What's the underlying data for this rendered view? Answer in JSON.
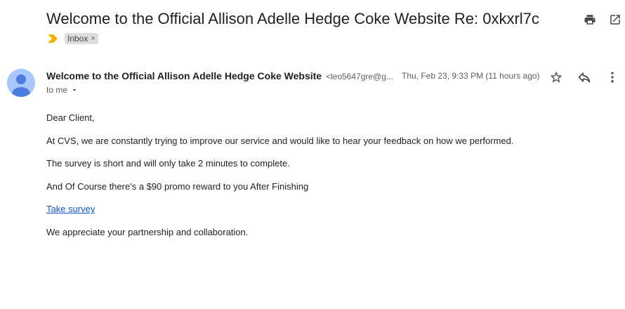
{
  "email": {
    "subject": "Welcome to the Official Allison Adelle Hedge Coke Website Re: 0xkxrl7c",
    "labels": [
      {
        "name": "Inbox",
        "remove": "×"
      }
    ],
    "sender": {
      "name": "Welcome to the Official Allison Adelle Hedge Coke Website",
      "email": "<leo5647gre@g..."
    },
    "date": "Thu, Feb 23, 9:33 PM (11 hours ago)",
    "recipient": "to me",
    "body": {
      "greeting": "Dear Client,",
      "paragraph1": "At CVS, we are constantly trying to improve our service and would like to hear your feedback on how we performed.",
      "paragraph2": "The survey is short and will only take 2 minutes to complete.",
      "paragraph3": "And Of Course there's a $90 promo reward to you After Finishing",
      "link_text": "Take survey",
      "closing": "We appreciate your partnership and collaboration."
    }
  },
  "icons": {
    "print": "print-icon",
    "open_new_window": "open-in-new-window-icon",
    "importance": "importance-marker-icon",
    "avatar": "default-avatar-icon",
    "star": "star-icon",
    "reply": "reply-icon",
    "more": "more-vertical-icon",
    "recipient_details": "chevron-down-icon"
  },
  "colors": {
    "importance_marker": "#f4b400",
    "link": "#1155cc",
    "label_chip": "#dddddd",
    "avatar_bg": "#a8c7fa",
    "avatar_fg": "#4b7de0"
  }
}
